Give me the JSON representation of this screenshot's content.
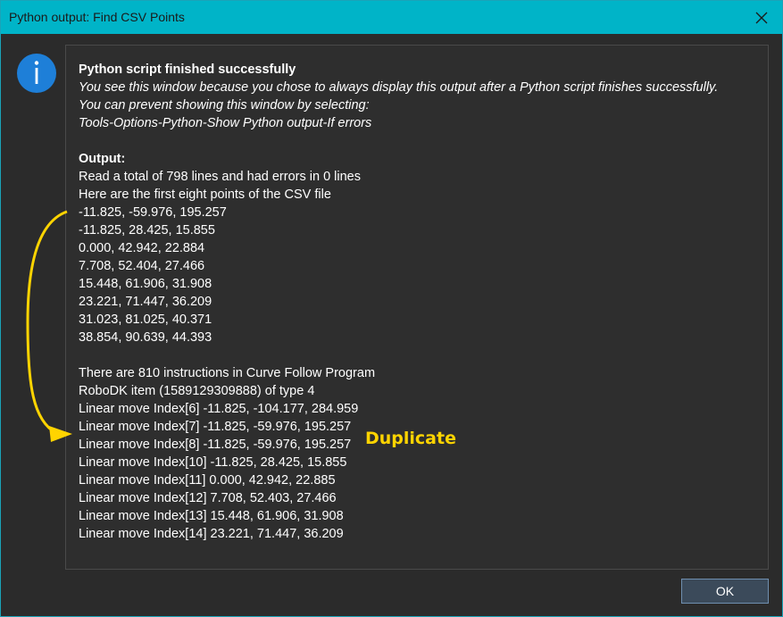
{
  "window": {
    "title": "Python output: Find CSV Points",
    "accent_color": "#00b4c8",
    "close_icon": "close-icon"
  },
  "info_icon": "info-icon",
  "message": {
    "heading": "Python script finished successfully",
    "note_lines": [
      "You see this window because you chose to always display this output after a Python script finishes successfully.",
      "You can prevent showing this window by selecting:",
      "Tools-Options-Python-Show Python output-If errors"
    ],
    "output_heading": "Output:",
    "output_lines": [
      "Read a total of 798 lines and had errors in 0 lines",
      "Here are the first eight points of the CSV file",
      "-11.825, -59.976, 195.257",
      "-11.825, 28.425, 15.855",
      "0.000, 42.942, 22.884",
      "7.708, 52.404, 27.466",
      "15.448, 61.906, 31.908",
      "23.221, 71.447, 36.209",
      "31.023, 81.025, 40.371",
      "38.854, 90.639, 44.393"
    ],
    "program_lines": [
      "There are 810 instructions in Curve Follow Program",
      "RoboDK item (1589129309888) of type 4",
      "Linear move Index[6] -11.825, -104.177, 284.959",
      "Linear move Index[7] -11.825, -59.976, 195.257",
      "Linear move Index[8] -11.825, -59.976, 195.257",
      "Linear move Index[10] -11.825, 28.425, 15.855",
      "Linear move Index[11] 0.000, 42.942, 22.885",
      "Linear move Index[12] 7.708, 52.403, 27.466",
      "Linear move Index[13] 15.448, 61.906, 31.908",
      "Linear move Index[14] 23.221, 71.447, 36.209"
    ]
  },
  "annotation": {
    "label": "Duplicate",
    "color": "#ffd400"
  },
  "buttons": {
    "ok_label": "OK"
  }
}
